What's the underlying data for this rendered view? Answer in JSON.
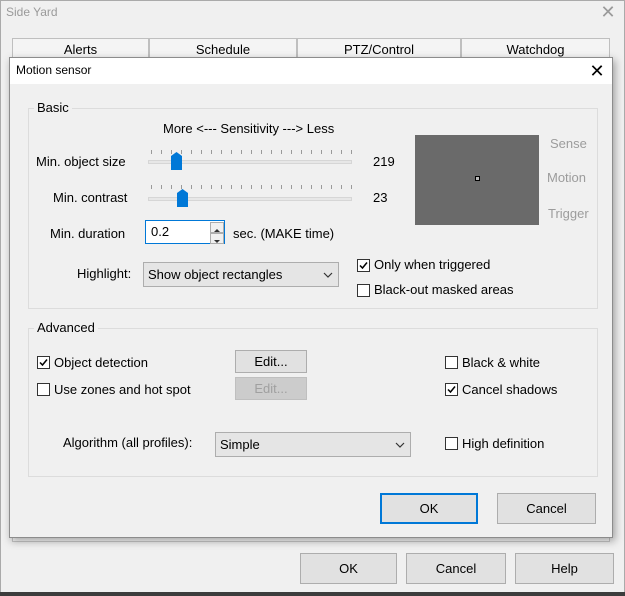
{
  "outer_window": {
    "title": "Side Yard",
    "close": "✕",
    "tabs": [
      "Alerts",
      "Schedule",
      "PTZ/Control",
      "Watchdog"
    ],
    "buttons": {
      "ok": "OK",
      "cancel": "Cancel",
      "help": "Help"
    }
  },
  "dialog": {
    "title": "Motion sensor",
    "close": "✕",
    "basic": {
      "group_label": "Basic",
      "sensitivity_label": "More <--- Sensitivity ---> Less",
      "min_object_size": {
        "label": "Min. object size",
        "value": "219",
        "level": 0.15
      },
      "min_contrast": {
        "label": "Min. contrast",
        "value": "23",
        "level": 0.15
      },
      "min_duration": {
        "label": "Min. duration",
        "value": "0.2",
        "unit": "sec.  (MAKE time)"
      },
      "highlight": {
        "label": "Highlight:",
        "selected": "Show object rectangles"
      },
      "only_when_triggered": {
        "label": "Only when triggered",
        "checked": true
      },
      "blackout_masked": {
        "label": "Black-out masked areas",
        "checked": false
      },
      "preview_labels": {
        "sense": "Sense",
        "motion": "Motion",
        "trigger": "Trigger"
      }
    },
    "advanced": {
      "group_label": "Advanced",
      "object_detection": {
        "label": "Object detection",
        "checked": true
      },
      "use_zones": {
        "label": "Use zones and hot spot",
        "checked": false
      },
      "edit_label": "Edit...",
      "edit_label_2": "Edit...",
      "black_white": {
        "label": "Black & white",
        "checked": false
      },
      "cancel_shadows": {
        "label": "Cancel shadows",
        "checked": true
      },
      "algorithm": {
        "label": "Algorithm (all profiles):",
        "selected": "Simple"
      },
      "high_definition": {
        "label": "High definition",
        "checked": false
      }
    },
    "buttons": {
      "ok": "OK",
      "cancel": "Cancel"
    }
  },
  "colors": {
    "accent": "#0078d7",
    "preview_bg": "#6a6a6a"
  }
}
